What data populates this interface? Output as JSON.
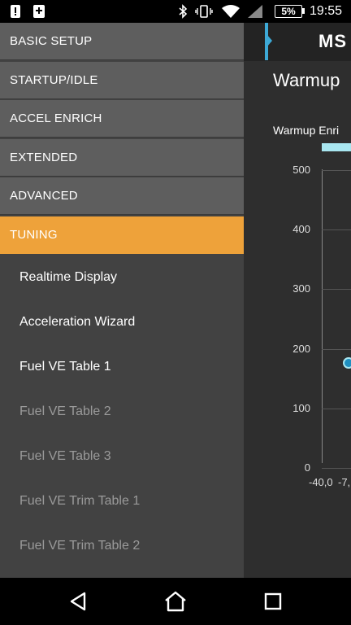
{
  "status_bar": {
    "battery": "5%",
    "time": "19:55",
    "icons": [
      "sim-icon",
      "download-icon",
      "bluetooth-icon",
      "vibrate-icon",
      "wifi-icon",
      "cell-signal-icon",
      "battery-icon"
    ]
  },
  "app": {
    "logo": "MS",
    "title": "Warmup",
    "chart_title": "Warmup Enri",
    "accent_color": "#3da9d6"
  },
  "chart_data": {
    "type": "scatter",
    "title": "Warmup Enri",
    "y_ticks": [
      "500",
      "400",
      "300",
      "200",
      "100",
      "0"
    ],
    "x_ticks": [
      "-40,0",
      "-7,"
    ],
    "ylim": [
      0,
      500
    ],
    "points": [
      {
        "x": -40,
        "y": 180
      }
    ],
    "grid": true
  },
  "drawer": {
    "sections": [
      {
        "label": "BASIC SETUP"
      },
      {
        "label": "STARTUP/IDLE"
      },
      {
        "label": "ACCEL ENRICH"
      },
      {
        "label": "EXTENDED"
      },
      {
        "label": "ADVANCED"
      },
      {
        "label": "TUNING"
      }
    ],
    "active_section": "TUNING",
    "active_color": "#eea23a",
    "items": [
      {
        "label": "Realtime Display"
      },
      {
        "label": "Acceleration Wizard"
      },
      {
        "label": "Fuel VE Table 1"
      },
      {
        "label": "Fuel VE Table 2"
      },
      {
        "label": "Fuel VE Table 3"
      },
      {
        "label": "Fuel VE Trim Table 1"
      },
      {
        "label": "Fuel VE Trim Table 2"
      }
    ]
  },
  "nav": {
    "icons": [
      "back-icon",
      "home-icon",
      "recents-icon"
    ]
  }
}
